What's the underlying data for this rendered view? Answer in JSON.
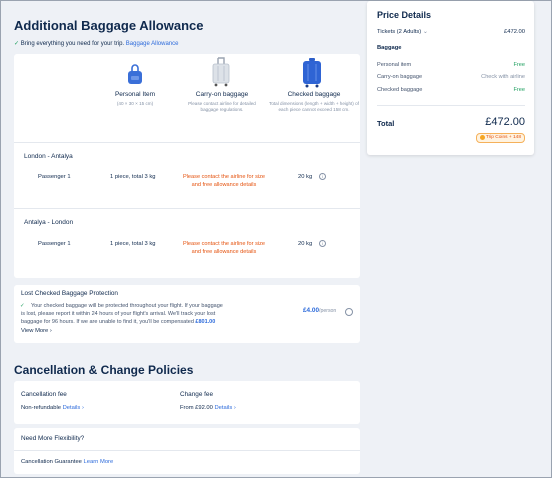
{
  "baggage": {
    "title": "Additional Baggage Allowance",
    "subtitle_text": "Bring everything you need for your trip.",
    "subtitle_link": "Baggage Allowance",
    "columns": [
      {
        "title": "Personal Item",
        "note": "(40 × 30 × 15 cm)"
      },
      {
        "title": "Carry-on baggage",
        "note": "Please contact airline for detailed baggage regulations."
      },
      {
        "title": "Checked baggage",
        "note": "Total dimensions (length + width + height) of each piece cannot exceed 158 cm."
      }
    ],
    "segments": [
      {
        "route": "London - Antalya",
        "passenger": "Passenger 1",
        "personal": "1 piece, total 3 kg",
        "carry_on": "Please contact the airline for size and free allowance details",
        "checked": "20 kg"
      },
      {
        "route": "Antalya - London",
        "passenger": "Passenger 1",
        "personal": "1 piece, total 3 kg",
        "carry_on": "Please contact the airline for size and free allowance details",
        "checked": "20 kg"
      }
    ]
  },
  "protection": {
    "title": "Lost Checked Baggage Protection",
    "line1": "Your checked baggage will be protected throughout your flight. If your baggage",
    "line2": "is lost, please report it within 24 hours of your flight's arrival. We'll track your lost",
    "line3_text": "baggage for 96 hours. If we are unable to find it, you'll be compensated",
    "line3_amount": "£801.00",
    "view_more": "View More",
    "price": "£4.00",
    "per": "/person"
  },
  "policies": {
    "title": "Cancellation & Change Policies",
    "cancel_label": "Cancellation fee",
    "cancel_value": "Non-refundable",
    "cancel_link": "Details",
    "change_label": "Change fee",
    "change_value": "From £92.00",
    "change_link": "Details"
  },
  "flex": {
    "title": "Need More Flexibility?",
    "guarantee_text": "Cancellation Guarantee",
    "guarantee_link": "Learn More"
  },
  "price": {
    "title": "Price Details",
    "tickets_label": "Tickets (2 Adults)",
    "tickets_value": "£472.00",
    "baggage_label": "Baggage",
    "items": [
      {
        "label": "Personal item",
        "value": "Free"
      },
      {
        "label": "Carry-on baggage",
        "value": "Check with airline"
      },
      {
        "label": "Checked baggage",
        "value": "Free"
      }
    ],
    "total_label": "Total",
    "total_value": "£472.00",
    "coins": "Trip Coins + 148"
  },
  "colors": {
    "accent": "#2d6bdb",
    "warning": "#e5530f",
    "free": "#20a060"
  }
}
